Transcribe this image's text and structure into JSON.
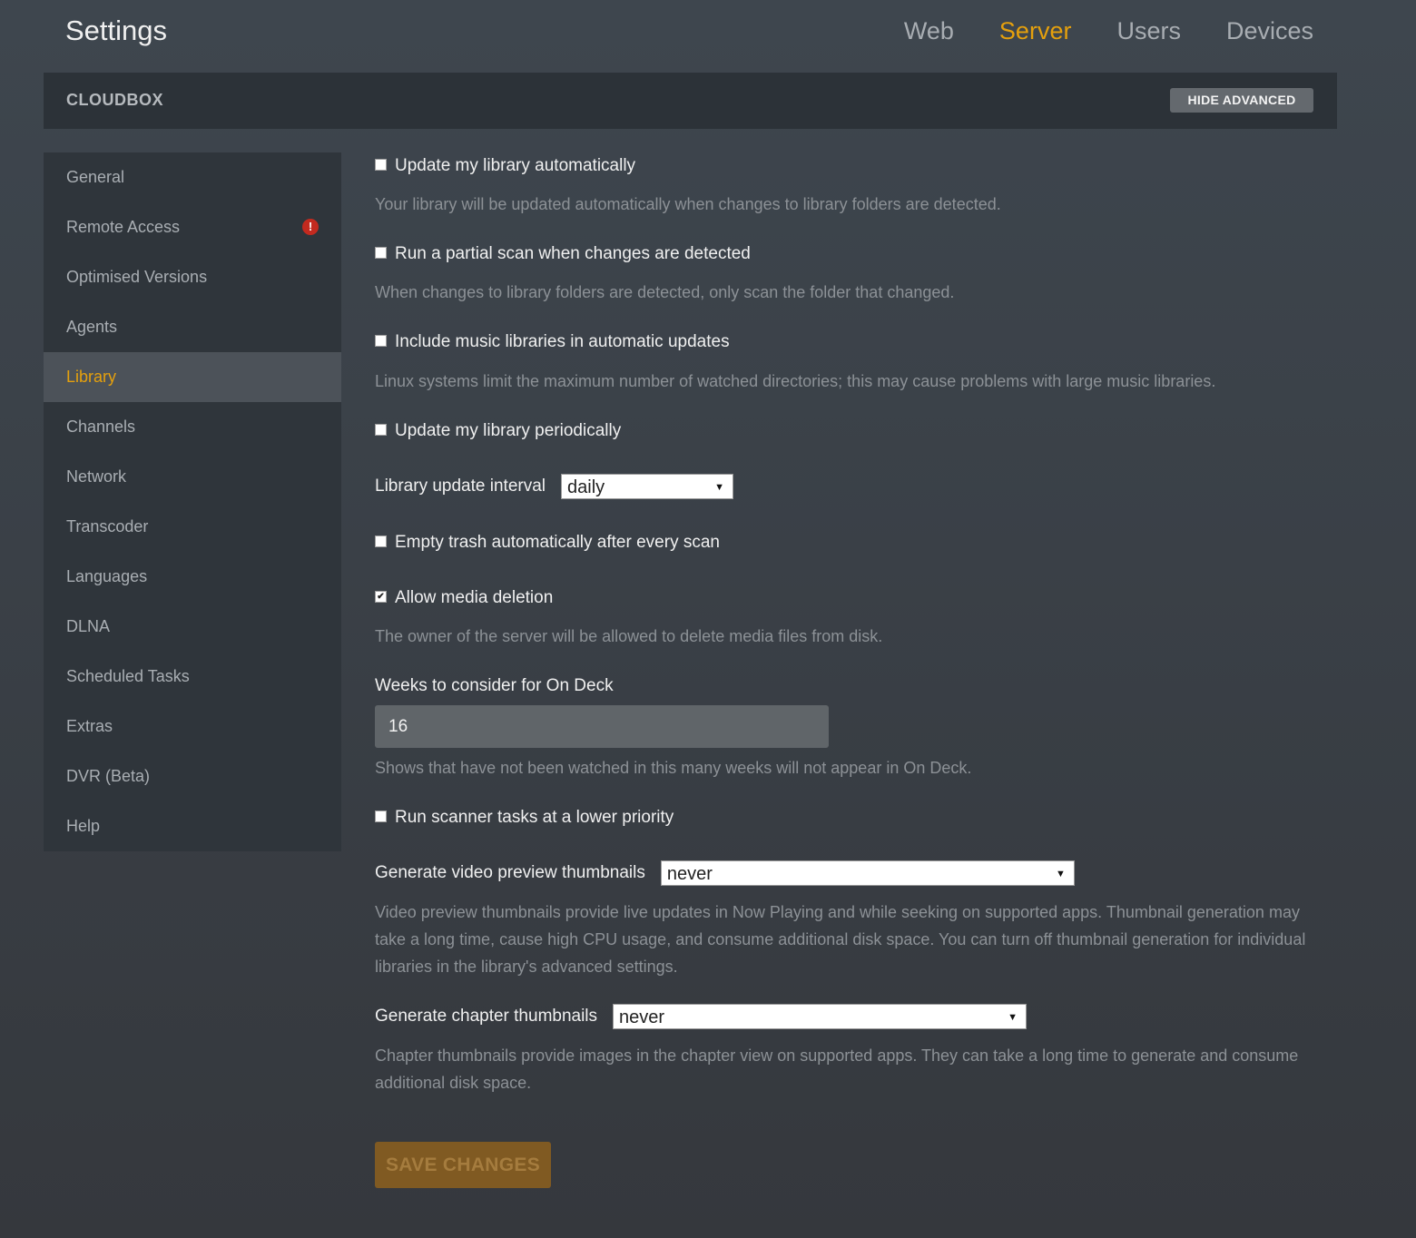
{
  "header": {
    "title": "Settings",
    "tabs": [
      {
        "label": "Web"
      },
      {
        "label": "Server"
      },
      {
        "label": "Users"
      },
      {
        "label": "Devices"
      }
    ],
    "active_tab": "Server"
  },
  "server_bar": {
    "name": "CLOUDBOX",
    "hide_advanced_label": "HIDE ADVANCED"
  },
  "sidebar": {
    "items": [
      {
        "label": "General"
      },
      {
        "label": "Remote Access"
      },
      {
        "label": "Optimised Versions"
      },
      {
        "label": "Agents"
      },
      {
        "label": "Library"
      },
      {
        "label": "Channels"
      },
      {
        "label": "Network"
      },
      {
        "label": "Transcoder"
      },
      {
        "label": "Languages"
      },
      {
        "label": "DLNA"
      },
      {
        "label": "Scheduled Tasks"
      },
      {
        "label": "Extras"
      },
      {
        "label": "DVR (Beta)"
      },
      {
        "label": "Help"
      }
    ],
    "active_item": "Library",
    "alert_item": "Remote Access"
  },
  "settings": {
    "update_auto": {
      "label": "Update my library automatically",
      "checked": false,
      "help": "Your library will be updated automatically when changes to library folders are detected."
    },
    "partial_scan": {
      "label": "Run a partial scan when changes are detected",
      "checked": false,
      "help": "When changes to library folders are detected, only scan the folder that changed."
    },
    "include_music": {
      "label": "Include music libraries in automatic updates",
      "checked": false,
      "help": "Linux systems limit the maximum number of watched directories; this may cause problems with large music libraries."
    },
    "update_periodic": {
      "label": "Update my library periodically",
      "checked": false
    },
    "update_interval": {
      "label": "Library update interval",
      "value": "daily"
    },
    "empty_trash": {
      "label": "Empty trash automatically after every scan",
      "checked": false
    },
    "allow_deletion": {
      "label": "Allow media deletion",
      "checked": true,
      "help": "The owner of the server will be allowed to delete media files from disk."
    },
    "on_deck_weeks": {
      "label": "Weeks to consider for On Deck",
      "value": "16",
      "help": "Shows that have not been watched in this many weeks will not appear in On Deck."
    },
    "low_priority": {
      "label": "Run scanner tasks at a lower priority",
      "checked": false
    },
    "video_thumbnails": {
      "label": "Generate video preview thumbnails",
      "value": "never",
      "help": "Video preview thumbnails provide live updates in Now Playing and while seeking on supported apps. Thumbnail generation may take a long time, cause high CPU usage, and consume additional disk space. You can turn off thumbnail generation for individual libraries in the library's advanced settings."
    },
    "chapter_thumbnails": {
      "label": "Generate chapter thumbnails",
      "value": "never",
      "help": "Chapter thumbnails provide images in the chapter view on supported apps. They can take a long time to generate and consume additional disk space."
    }
  },
  "save_label": "SAVE CHANGES",
  "icons": {
    "alert": "exclamation-circle-icon",
    "checkmark": "✔",
    "dropdown": "▼"
  },
  "colors": {
    "accent": "#e5a00d",
    "alert": "#c32a1f",
    "save_button": "#805a22"
  }
}
